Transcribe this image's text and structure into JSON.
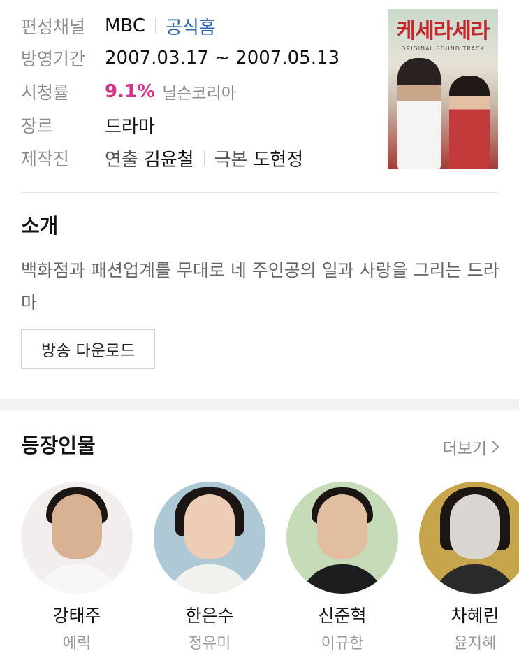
{
  "info": {
    "channel_label": "편성채널",
    "channel_value": "MBC",
    "channel_link": "공식홈",
    "period_label": "방영기간",
    "period_value": "2007.03.17 ~ 2007.05.13",
    "rating_label": "시청률",
    "rating_value": "9.1%",
    "rating_source": "닐슨코리아",
    "genre_label": "장르",
    "genre_value": "드라마",
    "crew_label": "제작진",
    "director_role": "연출",
    "director_name": "김윤철",
    "writer_role": "극본",
    "writer_name": "도현정",
    "poster_title": "케세라세라",
    "poster_subtitle": "ORIGINAL SOUND TRACK"
  },
  "intro": {
    "title": "소개",
    "description": "백화점과 패션업계를 무대로 네 주인공의 일과 사랑을 그리는 드라마",
    "download_label": "방송 다운로드"
  },
  "cast": {
    "title": "등장인물",
    "more_label": "더보기",
    "members": [
      {
        "character": "강태주",
        "actor": "에릭"
      },
      {
        "character": "한은수",
        "actor": "정유미"
      },
      {
        "character": "신준혁",
        "actor": "이규한"
      },
      {
        "character": "차혜린",
        "actor": "윤지혜"
      }
    ]
  },
  "colors": {
    "link": "#2f64b1",
    "rating": "#d6338a",
    "muted": "#8d8d8d",
    "section_gap": "#f1f1f4"
  }
}
